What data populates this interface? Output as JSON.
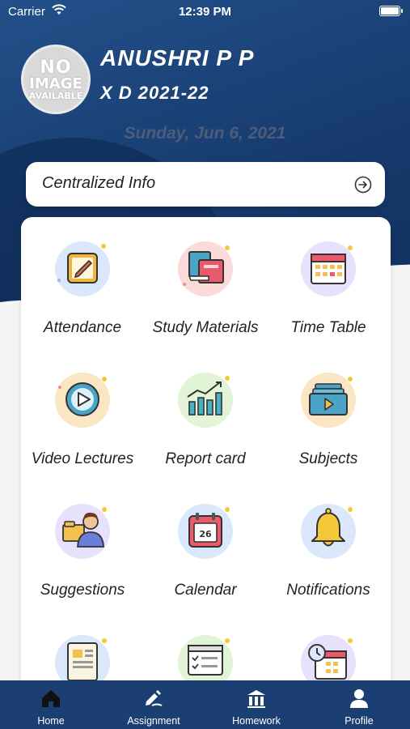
{
  "status_bar": {
    "carrier": "Carrier",
    "time": "12:39 PM"
  },
  "profile": {
    "avatar_text": {
      "line1": "NO",
      "line2": "IMAGE",
      "line3": "AVAILABLE"
    },
    "name": "ANUSHRI P P",
    "class": "X D 2021-22",
    "date": "Sunday, Jun 6, 2021"
  },
  "centralized": {
    "label": "Centralized Info",
    "icon": "arrow-right-circle-icon"
  },
  "menu": [
    {
      "label": "Attendance",
      "icon": "attendance-icon",
      "bg": "#dbe7fb"
    },
    {
      "label": "Study Materials",
      "icon": "books-icon",
      "bg": "#fbdada"
    },
    {
      "label": "Time Table",
      "icon": "calendar-grid-icon",
      "bg": "#e7e1fb"
    },
    {
      "label": "Video Lectures",
      "icon": "video-play-icon",
      "bg": "#fbe6c4"
    },
    {
      "label": "Report card",
      "icon": "bar-chart-icon",
      "bg": "#e2f4d6"
    },
    {
      "label": "Subjects",
      "icon": "video-stack-icon",
      "bg": "#fbe6c4"
    },
    {
      "label": "Suggestions",
      "icon": "person-folder-icon",
      "bg": "#e7e1fb"
    },
    {
      "label": "Calendar",
      "icon": "calendar-date-icon",
      "bg": "#dbe7fb"
    },
    {
      "label": "Notifications",
      "icon": "bell-icon",
      "bg": "#dbe7fb"
    },
    {
      "label": "",
      "icon": "newspaper-icon",
      "bg": "#dbe7fb"
    },
    {
      "label": "",
      "icon": "checklist-icon",
      "bg": "#e2f4d6"
    },
    {
      "label": "",
      "icon": "clock-calendar-icon",
      "bg": "#e7e1fb"
    }
  ],
  "tabs": [
    {
      "label": "Home",
      "icon": "home-icon"
    },
    {
      "label": "Assignment",
      "icon": "assignment-icon"
    },
    {
      "label": "Homework",
      "icon": "homework-icon"
    },
    {
      "label": "Profile",
      "icon": "profile-icon"
    }
  ],
  "colors": {
    "primary": "#1b3f73",
    "card": "#ffffff",
    "date_text": "#4b5d7a"
  }
}
